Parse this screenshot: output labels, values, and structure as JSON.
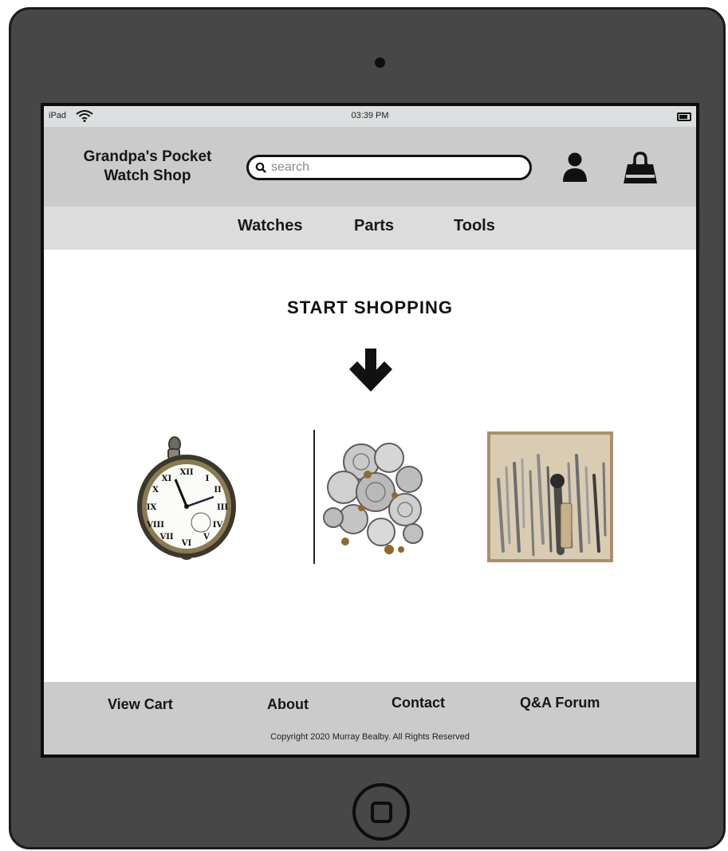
{
  "status_bar": {
    "device": "iPad",
    "time": "03:39 PM"
  },
  "header": {
    "brand_line1": "Grandpa's Pocket",
    "brand_line2": "Watch Shop",
    "search_placeholder": "search"
  },
  "nav": {
    "items": [
      "Watches",
      "Parts",
      "Tools"
    ]
  },
  "main": {
    "heading": "START SHOPPING",
    "categories": [
      {
        "icon": "pocket-watch-image"
      },
      {
        "icon": "watch-parts-image"
      },
      {
        "icon": "watch-tools-image"
      }
    ]
  },
  "footer": {
    "links": [
      "View Cart",
      "About",
      "Contact",
      "Q&A Forum"
    ],
    "copyright": "Copyright  2020 Murray Bealby. All Rights Reserved"
  },
  "colors": {
    "device_body": "#474747",
    "status_bar": "#dcdfe0",
    "header_bg": "#cbcbcb",
    "nav_bg": "#dcdcdc",
    "footer_bg": "#cbcbcb"
  },
  "icons": [
    "wifi-icon",
    "battery-icon",
    "search-icon",
    "user-icon",
    "shopping-bag-icon",
    "arrow-down-icon",
    "home-button"
  ]
}
